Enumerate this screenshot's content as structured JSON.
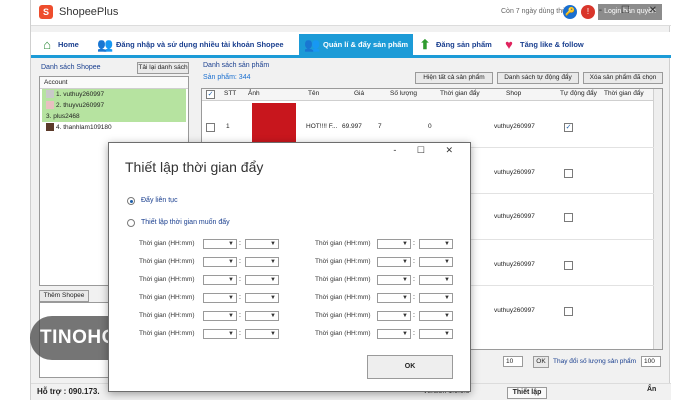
{
  "app": {
    "title": "ShopeePlus",
    "trial_text": "Còn 7 ngày dùng thử",
    "login_button": "Login bản quyền",
    "window_controls": "- ☐ ✕"
  },
  "menu": [
    {
      "label": "Home",
      "icon": "home-icon"
    },
    {
      "label": "Đăng nhập và sử dụng nhiều tài khoản Shopee",
      "icon": "users-icon"
    },
    {
      "label": "Quản lí & đẩy sản phẩm",
      "icon": "group-icon"
    },
    {
      "label": "Đăng sản phẩm",
      "icon": "up-arrow-icon"
    },
    {
      "label": "Tăng like & follow",
      "icon": "heart-icon"
    }
  ],
  "left": {
    "panel_title": "Danh sách Shopee",
    "reload_button": "Tải lại danh sách",
    "column_header": "Account",
    "accounts": [
      "1. vuthuy260997",
      "2. thuyvu260997",
      "3. plus2468",
      "4. thanhlam109180"
    ],
    "add_button": "Thêm Shopee"
  },
  "right": {
    "panel_title": "Danh sách sản phẩm",
    "count_text": "Sản phẩm: 344",
    "show_all_button": "Hiện tất cả sản phẩm",
    "auto_push_button": "Danh sách tự động đẩy",
    "delete_button": "Xóa sản phẩm đã chọn",
    "columns": [
      "STT",
      "Ảnh",
      "Tên",
      "Giá",
      "Số lượng",
      "Thời gian đẩy",
      "Shop",
      "Tự động đẩy",
      "Thời gian đẩy"
    ],
    "row1": {
      "stt": "1",
      "name": "HOT!!!! F...",
      "price": "69.997",
      "qty": "7",
      "push_time": "0",
      "shop": "vuthuy260997"
    },
    "shops": [
      "vuthuy260997",
      "vuthuy260997",
      "vuthuy260997",
      "vuthuy260997"
    ],
    "page_size": "10",
    "ok_label": "OK",
    "change_count_text": "Thay đổi số lượng sản phẩm",
    "count_input": "100"
  },
  "dialog": {
    "title": "Thiết lập thời gian đẩy",
    "option_continuous": "Đẩy liên tục",
    "option_custom": "Thiết lập thời gian muốn đẩy",
    "time_label": "Thời gian (HH:mm)",
    "colon": ":",
    "ok_button": "OK",
    "controls": "- ☐ ✕"
  },
  "status": {
    "support": "Hỗ trợ : 090.173.",
    "version": "Version 1.0.0.5",
    "setting": "Thiết lập",
    "hide": "Ẩn"
  },
  "watermark": "TINOHOST"
}
